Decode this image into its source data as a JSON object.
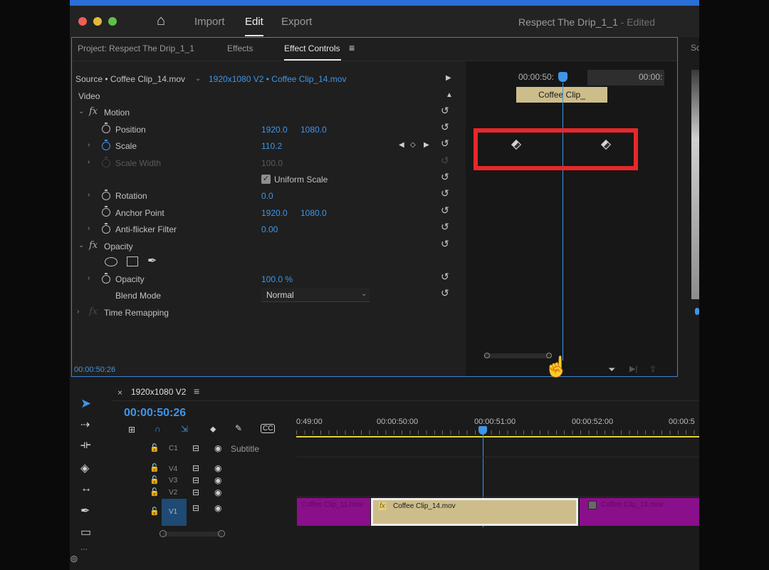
{
  "window": {
    "nav": {
      "home": "⌂",
      "import": "Import",
      "edit": "Edit",
      "export": "Export"
    },
    "project_title": "Respect The Drip_1_1",
    "status": "- Edited"
  },
  "tabs": {
    "project": "Project: Respect The Drip_1_1",
    "effects": "Effects",
    "effect_controls": "Effect Controls",
    "menu_icon": "≡"
  },
  "right_panel_fragment": "So",
  "source_bar": {
    "source": "Source • Coffee Clip_14.mov",
    "sequence": "1920x1080 V2 • Coffee Clip_14.mov"
  },
  "mini_timeline": {
    "time": "00:00:50:",
    "time_right": "00:00:",
    "clip_label": "Coffee Clip_"
  },
  "effect_controls": {
    "video_heading": "Video",
    "motion": "Motion",
    "position": {
      "label": "Position",
      "x": "1920.0",
      "y": "1080.0"
    },
    "scale": {
      "label": "Scale",
      "value": "110.2"
    },
    "scale_width": {
      "label": "Scale Width",
      "value": "100.0"
    },
    "uniform_scale": "Uniform Scale",
    "rotation": {
      "label": "Rotation",
      "value": "0.0"
    },
    "anchor_point": {
      "label": "Anchor Point",
      "x": "1920.0",
      "y": "1080.0"
    },
    "anti_flicker": {
      "label": "Anti-flicker Filter",
      "value": "0.00"
    },
    "opacity_section": "Opacity",
    "opacity": {
      "label": "Opacity",
      "value": "100.0 %"
    },
    "blend_mode": {
      "label": "Blend Mode",
      "value": "Normal"
    },
    "time_remapping": "Time Remapping",
    "fx_symbol": "fx",
    "current_time": "00:00:50:26"
  },
  "sequence": {
    "close": "×",
    "name": "1920x1080 V2",
    "menu_icon": "≡",
    "timecode": "00:00:50:26",
    "ruler": [
      "0:49:00",
      "00:00:50:00",
      "00:00:51:00",
      "00:00:52:00",
      "00:00:5"
    ],
    "tracks": {
      "c1": "C1",
      "subtitle": "Subtitle",
      "v4": "V4",
      "v3": "V3",
      "v2": "V2",
      "v1": "V1"
    },
    "clips": {
      "left": "Coffee Clip_11.mov",
      "center": "Coffee Clip_14.mov",
      "right": "Coffee Clip_13.mov"
    }
  },
  "colors": {
    "accent": "#3f95e8",
    "highlight": "#e8272a",
    "clip_tan": "#cdbd8b",
    "clip_purple": "#8a0f8a"
  }
}
